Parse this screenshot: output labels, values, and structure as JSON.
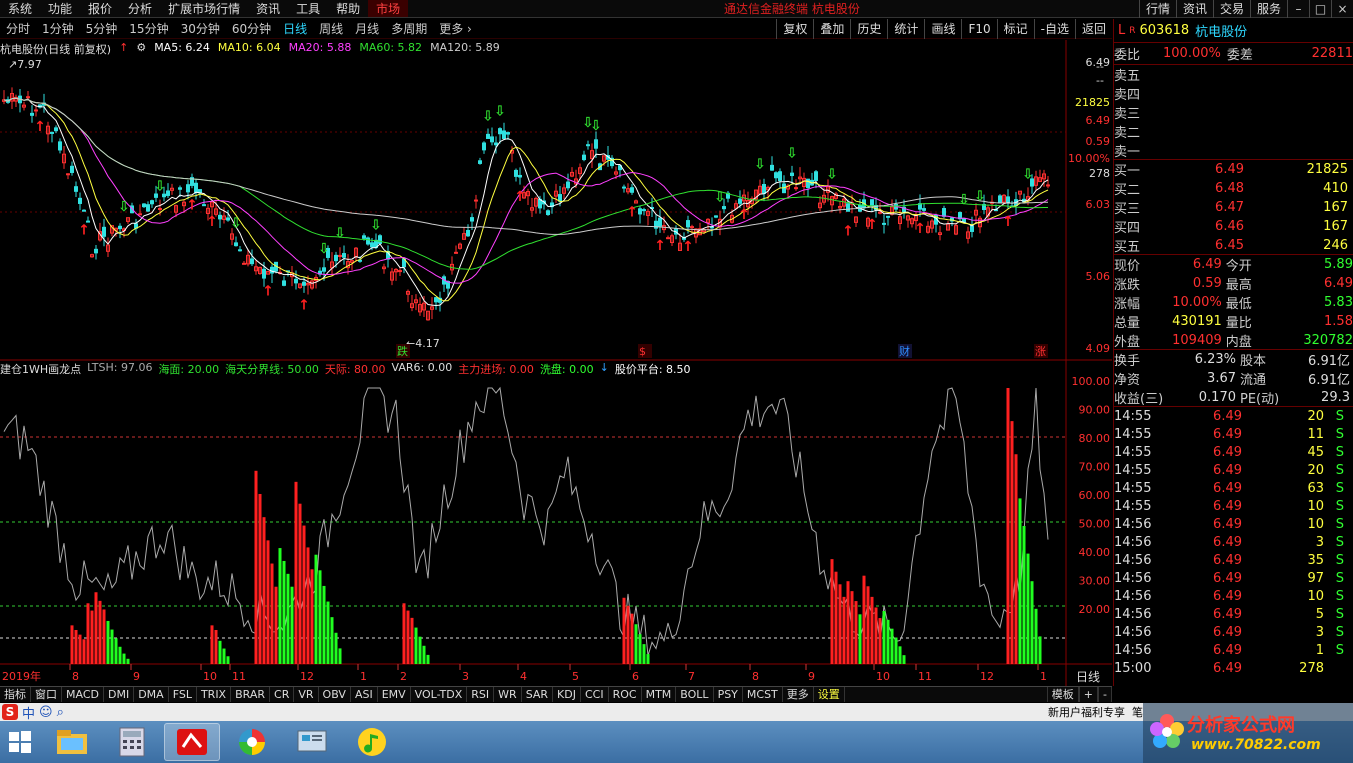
{
  "menubar": {
    "items": [
      "系统",
      "功能",
      "报价",
      "分析",
      "扩展市场行情",
      "资讯",
      "工具",
      "帮助"
    ],
    "market": "市场",
    "title": "通达信金融终端  杭电股份",
    "right": [
      "行情",
      "资讯",
      "交易",
      "服务"
    ]
  },
  "periods": {
    "items": [
      "分时",
      "1分钟",
      "5分钟",
      "15分钟",
      "30分钟",
      "60分钟",
      "日线",
      "周线",
      "月线",
      "多周期",
      "更多"
    ],
    "selected": 6
  },
  "tools": [
    "复权",
    "叠加",
    "历史",
    "统计",
    "画线",
    "F10",
    "标记",
    "-自选",
    "返回"
  ],
  "ma_line": {
    "name": "杭电股份(日线 前复权)",
    "ma5": "MA5: 6.24",
    "ma10": "MA10: 6.04",
    "ma20": "MA20: 5.88",
    "ma60": "MA60: 5.82",
    "ma120": "MA120: 5.89"
  },
  "price_axis": {
    "labels": [
      "6.49",
      "21825",
      "6.49",
      "0.59",
      "10.00%",
      "278",
      "6.03",
      "5.06",
      "4.09"
    ],
    "top_price": "7.97",
    "low_price": "4.17"
  },
  "main_marks": {
    "die": "跌",
    "s": "$",
    "cai": "财",
    "zhang": "涨"
  },
  "indicator_line": {
    "name": "建仓1WH画龙点",
    "ltsh": "LTSH: 97.06",
    "haimian": "海面: 20.00",
    "haitian": "海天分界线: 50.00",
    "tianji": "天际: 80.00",
    "var6": "VAR6: 0.00",
    "zhuli": "主力进场: 0.00",
    "xipan": "洗盘: 0.00",
    "pingtai": "股价平台: 8.50"
  },
  "ind_axis": [
    "100.00",
    "90.00",
    "80.00",
    "70.00",
    "60.00",
    "50.00",
    "40.00",
    "30.00",
    "20.00"
  ],
  "x_axis": {
    "year": "2019年",
    "months": [
      "8",
      "9",
      "10",
      "11",
      "12",
      "1",
      "2",
      "3",
      "4",
      "5",
      "6",
      "7",
      "8",
      "9",
      "10",
      "11",
      "12",
      "1"
    ],
    "period": "日线"
  },
  "bottom_tabs": [
    "指标",
    "窗口",
    "MACD",
    "DMI",
    "DMA",
    "FSL",
    "TRIX",
    "BRAR",
    "CR",
    "VR",
    "OBV",
    "ASI",
    "EMV",
    "VOL-TDX",
    "RSI",
    "WR",
    "SAR",
    "KDJ",
    "CCI",
    "ROC",
    "MTM",
    "BOLL",
    "PSY",
    "MCST",
    "更多",
    "设置"
  ],
  "bottom_right": [
    "模板",
    "+",
    "-"
  ],
  "status_text": "新用户福利专享",
  "status_pen": "笔",
  "ime": {
    "zh": "中"
  },
  "side": {
    "code": "603618",
    "name": "杭电股份",
    "flag": "R",
    "weibi_lbl": "委比",
    "weibi": "100.00%",
    "weicha_lbl": "委差",
    "weicha": "22811",
    "sell": [
      {
        "l": "卖五",
        "p": "",
        "v": ""
      },
      {
        "l": "卖四",
        "p": "",
        "v": ""
      },
      {
        "l": "卖三",
        "p": "",
        "v": ""
      },
      {
        "l": "卖二",
        "p": "",
        "v": ""
      },
      {
        "l": "卖一",
        "p": "",
        "v": ""
      }
    ],
    "buy": [
      {
        "l": "买一",
        "p": "6.49",
        "v": "21825"
      },
      {
        "l": "买二",
        "p": "6.48",
        "v": "410"
      },
      {
        "l": "买三",
        "p": "6.47",
        "v": "167"
      },
      {
        "l": "买四",
        "p": "6.46",
        "v": "167"
      },
      {
        "l": "买五",
        "p": "6.45",
        "v": "246"
      }
    ],
    "stats": [
      {
        "a": "现价",
        "av": "6.49",
        "b": "今开",
        "bv": "5.89",
        "ac": "r",
        "bc": "g"
      },
      {
        "a": "涨跌",
        "av": "0.59",
        "b": "最高",
        "bv": "6.49",
        "ac": "r",
        "bc": "r"
      },
      {
        "a": "涨幅",
        "av": "10.00%",
        "b": "最低",
        "bv": "5.83",
        "ac": "r",
        "bc": "g"
      },
      {
        "a": "总量",
        "av": "430191",
        "b": "量比",
        "bv": "1.58",
        "ac": "y",
        "bc": "r"
      },
      {
        "a": "外盘",
        "av": "109409",
        "b": "内盘",
        "bv": "320782",
        "ac": "r",
        "bc": "g"
      }
    ],
    "stats2": [
      {
        "a": "换手",
        "av": "6.23%",
        "b": "股本",
        "bv": "6.91亿"
      },
      {
        "a": "净资",
        "av": "3.67",
        "b": "流通",
        "bv": "6.91亿"
      },
      {
        "a": "收益(三)",
        "av": "0.170",
        "b": "PE(动)",
        "bv": "29.3"
      }
    ],
    "ticks": [
      {
        "t": "14:55",
        "p": "6.49",
        "v": "20",
        "s": "S"
      },
      {
        "t": "14:55",
        "p": "6.49",
        "v": "11",
        "s": "S"
      },
      {
        "t": "14:55",
        "p": "6.49",
        "v": "45",
        "s": "S"
      },
      {
        "t": "14:55",
        "p": "6.49",
        "v": "20",
        "s": "S"
      },
      {
        "t": "14:55",
        "p": "6.49",
        "v": "63",
        "s": "S"
      },
      {
        "t": "14:55",
        "p": "6.49",
        "v": "10",
        "s": "S"
      },
      {
        "t": "14:56",
        "p": "6.49",
        "v": "10",
        "s": "S"
      },
      {
        "t": "14:56",
        "p": "6.49",
        "v": "3",
        "s": "S"
      },
      {
        "t": "14:56",
        "p": "6.49",
        "v": "35",
        "s": "S"
      },
      {
        "t": "14:56",
        "p": "6.49",
        "v": "97",
        "s": "S"
      },
      {
        "t": "14:56",
        "p": "6.49",
        "v": "10",
        "s": "S"
      },
      {
        "t": "14:56",
        "p": "6.49",
        "v": "5",
        "s": "S"
      },
      {
        "t": "14:56",
        "p": "6.49",
        "v": "3",
        "s": "S"
      },
      {
        "t": "14:56",
        "p": "6.49",
        "v": "1",
        "s": "S"
      },
      {
        "t": "15:00",
        "p": "6.49",
        "v": "278",
        "s": ""
      }
    ]
  },
  "watermark": {
    "t1": "分析家公式网",
    "t2": "www.70822.com"
  },
  "colors": {
    "up": "#ff3030",
    "down": "#30ff30",
    "ma5": "#ffffff",
    "ma10": "#ffff40",
    "ma20": "#ff40ff",
    "ma60": "#30e030",
    "ma120": "#cccccc"
  }
}
